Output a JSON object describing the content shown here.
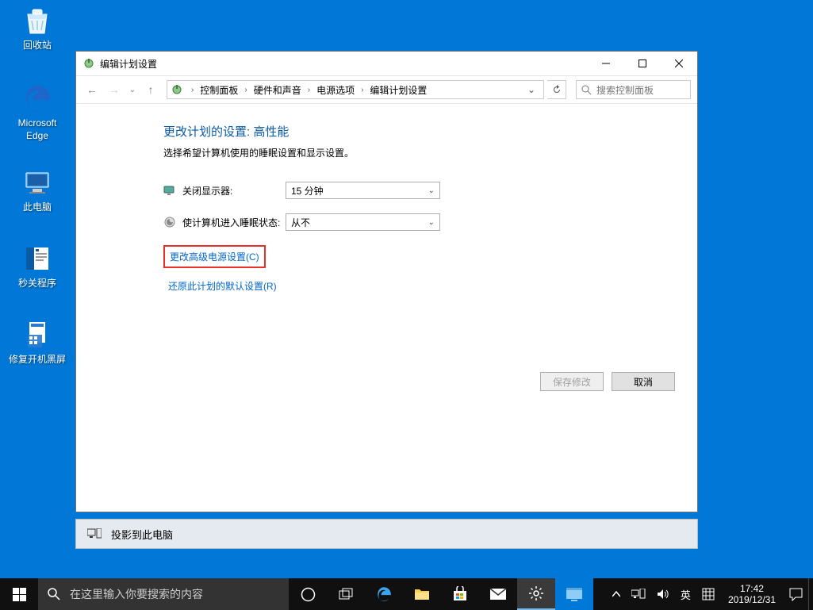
{
  "desktop": {
    "icons": [
      {
        "name": "recycle-bin",
        "label": "回收站"
      },
      {
        "name": "edge",
        "label": "Microsoft Edge"
      },
      {
        "name": "this-pc",
        "label": "此电脑"
      },
      {
        "name": "sec-shutdown",
        "label": "秒关程序"
      },
      {
        "name": "repair-boot",
        "label": "修复开机黑屏"
      }
    ]
  },
  "window": {
    "title": "编辑计划设置",
    "breadcrumb": [
      "控制面板",
      "硬件和声音",
      "电源选项",
      "编辑计划设置"
    ],
    "search_placeholder": "搜索控制面板",
    "heading": "更改计划的设置: 高性能",
    "subheading": "选择希望计算机使用的睡眠设置和显示设置。",
    "settings": {
      "display_off": {
        "label": "关闭显示器:",
        "value": "15 分钟"
      },
      "sleep": {
        "label": "使计算机进入睡眠状态:",
        "value": "从不"
      }
    },
    "links": {
      "advanced": "更改高级电源设置(C)",
      "restore": "还原此计划的默认设置(R)"
    },
    "buttons": {
      "save": "保存修改",
      "cancel": "取消"
    }
  },
  "notification": {
    "text": "投影到此电脑"
  },
  "taskbar": {
    "search_placeholder": "在这里输入你要搜索的内容",
    "ime_lang": "英",
    "clock": {
      "time": "17:42",
      "date": "2019/12/31"
    }
  }
}
